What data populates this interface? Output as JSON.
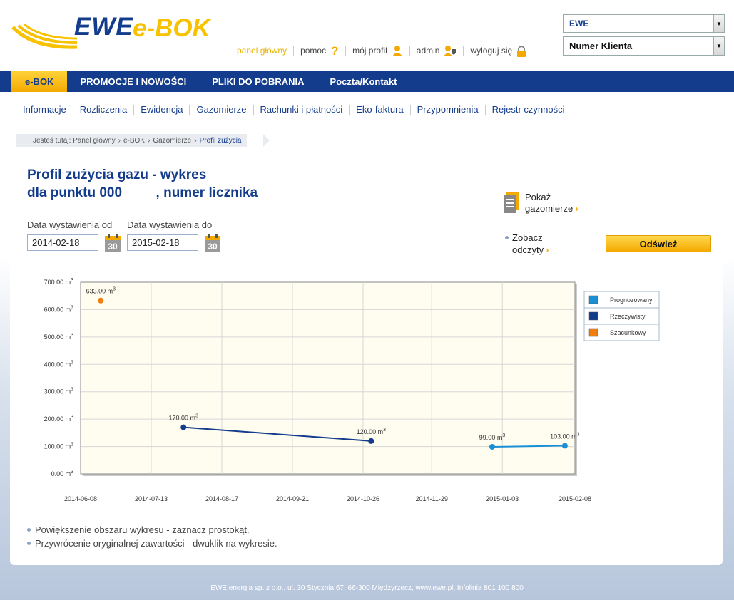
{
  "header": {
    "logo_ewe": "EWE",
    "logo_ebok": "e-BOK",
    "links": [
      {
        "label": "panel główny",
        "icon": ""
      },
      {
        "label": "pomoc",
        "icon": "question-icon"
      },
      {
        "label": "mój profil",
        "icon": "user-icon"
      },
      {
        "label": "admin",
        "icon": "admin-shield-icon"
      },
      {
        "label": "wyloguj się",
        "icon": "lock-icon"
      }
    ],
    "company_select": "EWE",
    "client_select": "Numer Klienta"
  },
  "mainnav": [
    "e-BOK",
    "PROMOCJE I NOWOŚCI",
    "PLIKI DO POBRANIA",
    "Poczta/Kontakt"
  ],
  "subnav": [
    "Informacje",
    "Rozliczenia",
    "Ewidencja",
    "Gazomierze",
    "Rachunki i płatności",
    "Eko-faktura",
    "Przypomnienia",
    "Rejestr czynności"
  ],
  "breadcrumb": {
    "prefix": "Jesteś tutaj:",
    "items": [
      "Panel główny",
      "e-BOK",
      "Gazomierze",
      "Profil zużycia"
    ]
  },
  "title": {
    "line1": "Profil zużycia gazu - wykres",
    "line2": "dla punktu 000         , numer licznika"
  },
  "form": {
    "from_label": "Data wystawienia od",
    "from_value": "2014-02-18",
    "to_label": "Data wystawienia do",
    "to_value": "2015-02-18",
    "calendar_day": "30"
  },
  "side_links": {
    "show_meters_1": "Pokaż",
    "show_meters_2": "gazomierze",
    "see_readings_1": "Zobacz",
    "see_readings_2": "odczyty"
  },
  "refresh_button": "Odśwież",
  "chart_data": {
    "type": "line",
    "x_ticks": [
      "2014-06-08",
      "2014-07-13",
      "2014-08-17",
      "2014-09-21",
      "2014-10-26",
      "2014-11-29",
      "2015-01-03",
      "2015-02-08"
    ],
    "y_ticks": [
      "0.00",
      "100.00",
      "200.00",
      "300.00",
      "400.00",
      "500.00",
      "600.00",
      "700.00"
    ],
    "y_unit": "m",
    "ylim": [
      0,
      700
    ],
    "xlim": [
      "2014-06-08",
      "2015-02-08"
    ],
    "grid": true,
    "legend_position": "right",
    "series": [
      {
        "name": "Prognozowany",
        "color": "#1a8fd6",
        "points": [
          {
            "x": "2014-12-29",
            "y": 99,
            "label": "99.00 m"
          },
          {
            "x": "2015-02-03",
            "y": 103,
            "label": "103.00 m"
          }
        ]
      },
      {
        "name": "Rzeczywisty",
        "color": "#143c8c",
        "points": [
          {
            "x": "2014-07-29",
            "y": 170,
            "label": "170.00 m"
          },
          {
            "x": "2014-10-30",
            "y": 120,
            "label": "120.00 m"
          }
        ]
      },
      {
        "name": "Szacunkowy",
        "color": "#f07d10",
        "points": [
          {
            "x": "2014-06-18",
            "y": 633,
            "label": "633.00 m"
          }
        ]
      }
    ]
  },
  "hints": [
    "Powiększenie obszaru wykresu - zaznacz prostokąt.",
    "Przywrócenie oryginalnej zawartości - dwuklik na wykresie."
  ],
  "footer": "EWE energia sp. z o.o., ul. 30 Stycznia 67, 66-300 Międzyrzecz, www.ewe.pl, Infolinia 801 100 800"
}
